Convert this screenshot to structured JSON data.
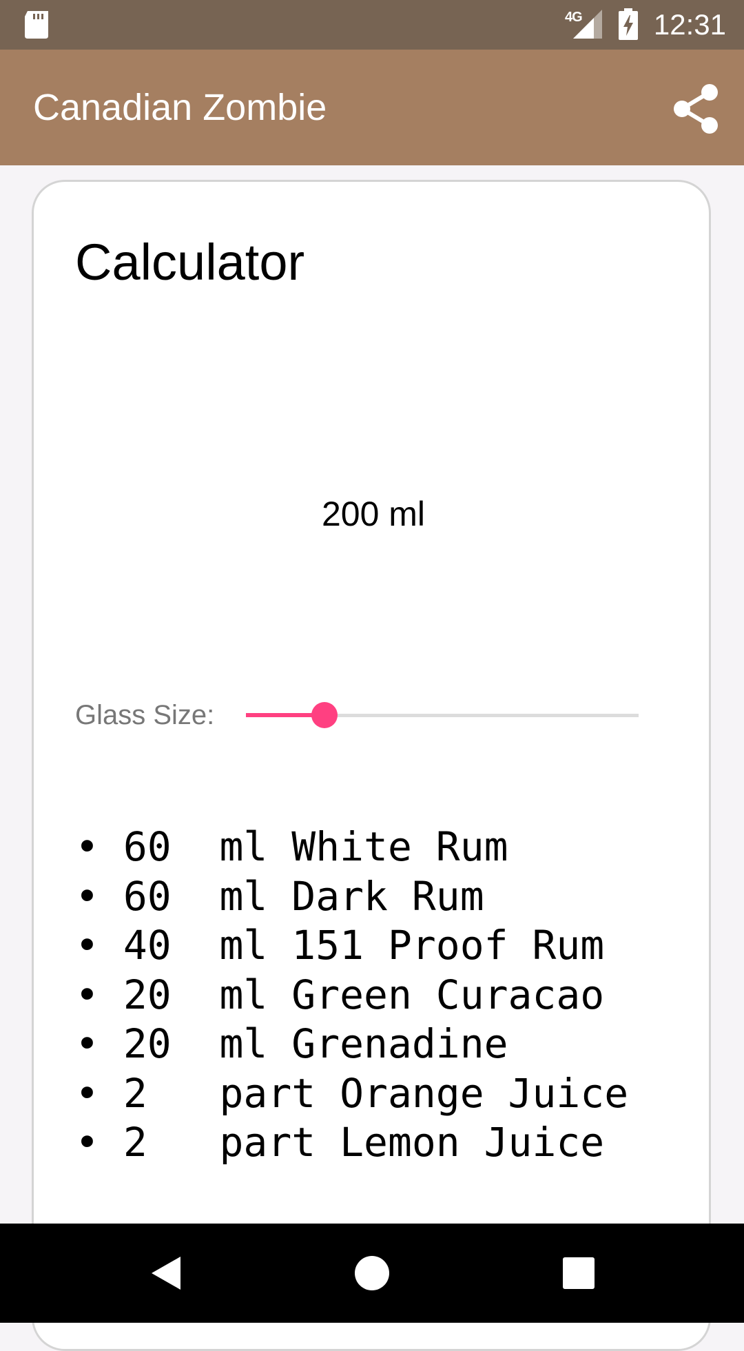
{
  "status_bar": {
    "network": "4G",
    "time": "12:31",
    "icons": [
      "sd-card-icon",
      "cell-signal-icon",
      "battery-charging-icon"
    ]
  },
  "app_bar": {
    "title": "Canadian Zombie",
    "share_icon": "share-icon"
  },
  "card": {
    "title": "Calculator",
    "volume": "200 ml",
    "glass_size_label": "Glass Size:",
    "slider_fraction": 0.2
  },
  "ingredients": [
    {
      "text": "• 60  ml White Rum"
    },
    {
      "text": "• 60  ml Dark Rum"
    },
    {
      "text": "• 40  ml 151 Proof Rum"
    },
    {
      "text": "• 20  ml Green Curacao"
    },
    {
      "text": "• 20  ml Grenadine"
    },
    {
      "text": "• 2   part Orange Juice"
    },
    {
      "text": "• 2   part Lemon Juice"
    }
  ],
  "nav_bar": {
    "icons": [
      "back-icon",
      "home-icon",
      "recents-icon"
    ]
  },
  "colors": {
    "status_bar": "#776453",
    "app_bar": "#a57f61",
    "accent": "#ff4081",
    "background": "#f6f4f7"
  }
}
